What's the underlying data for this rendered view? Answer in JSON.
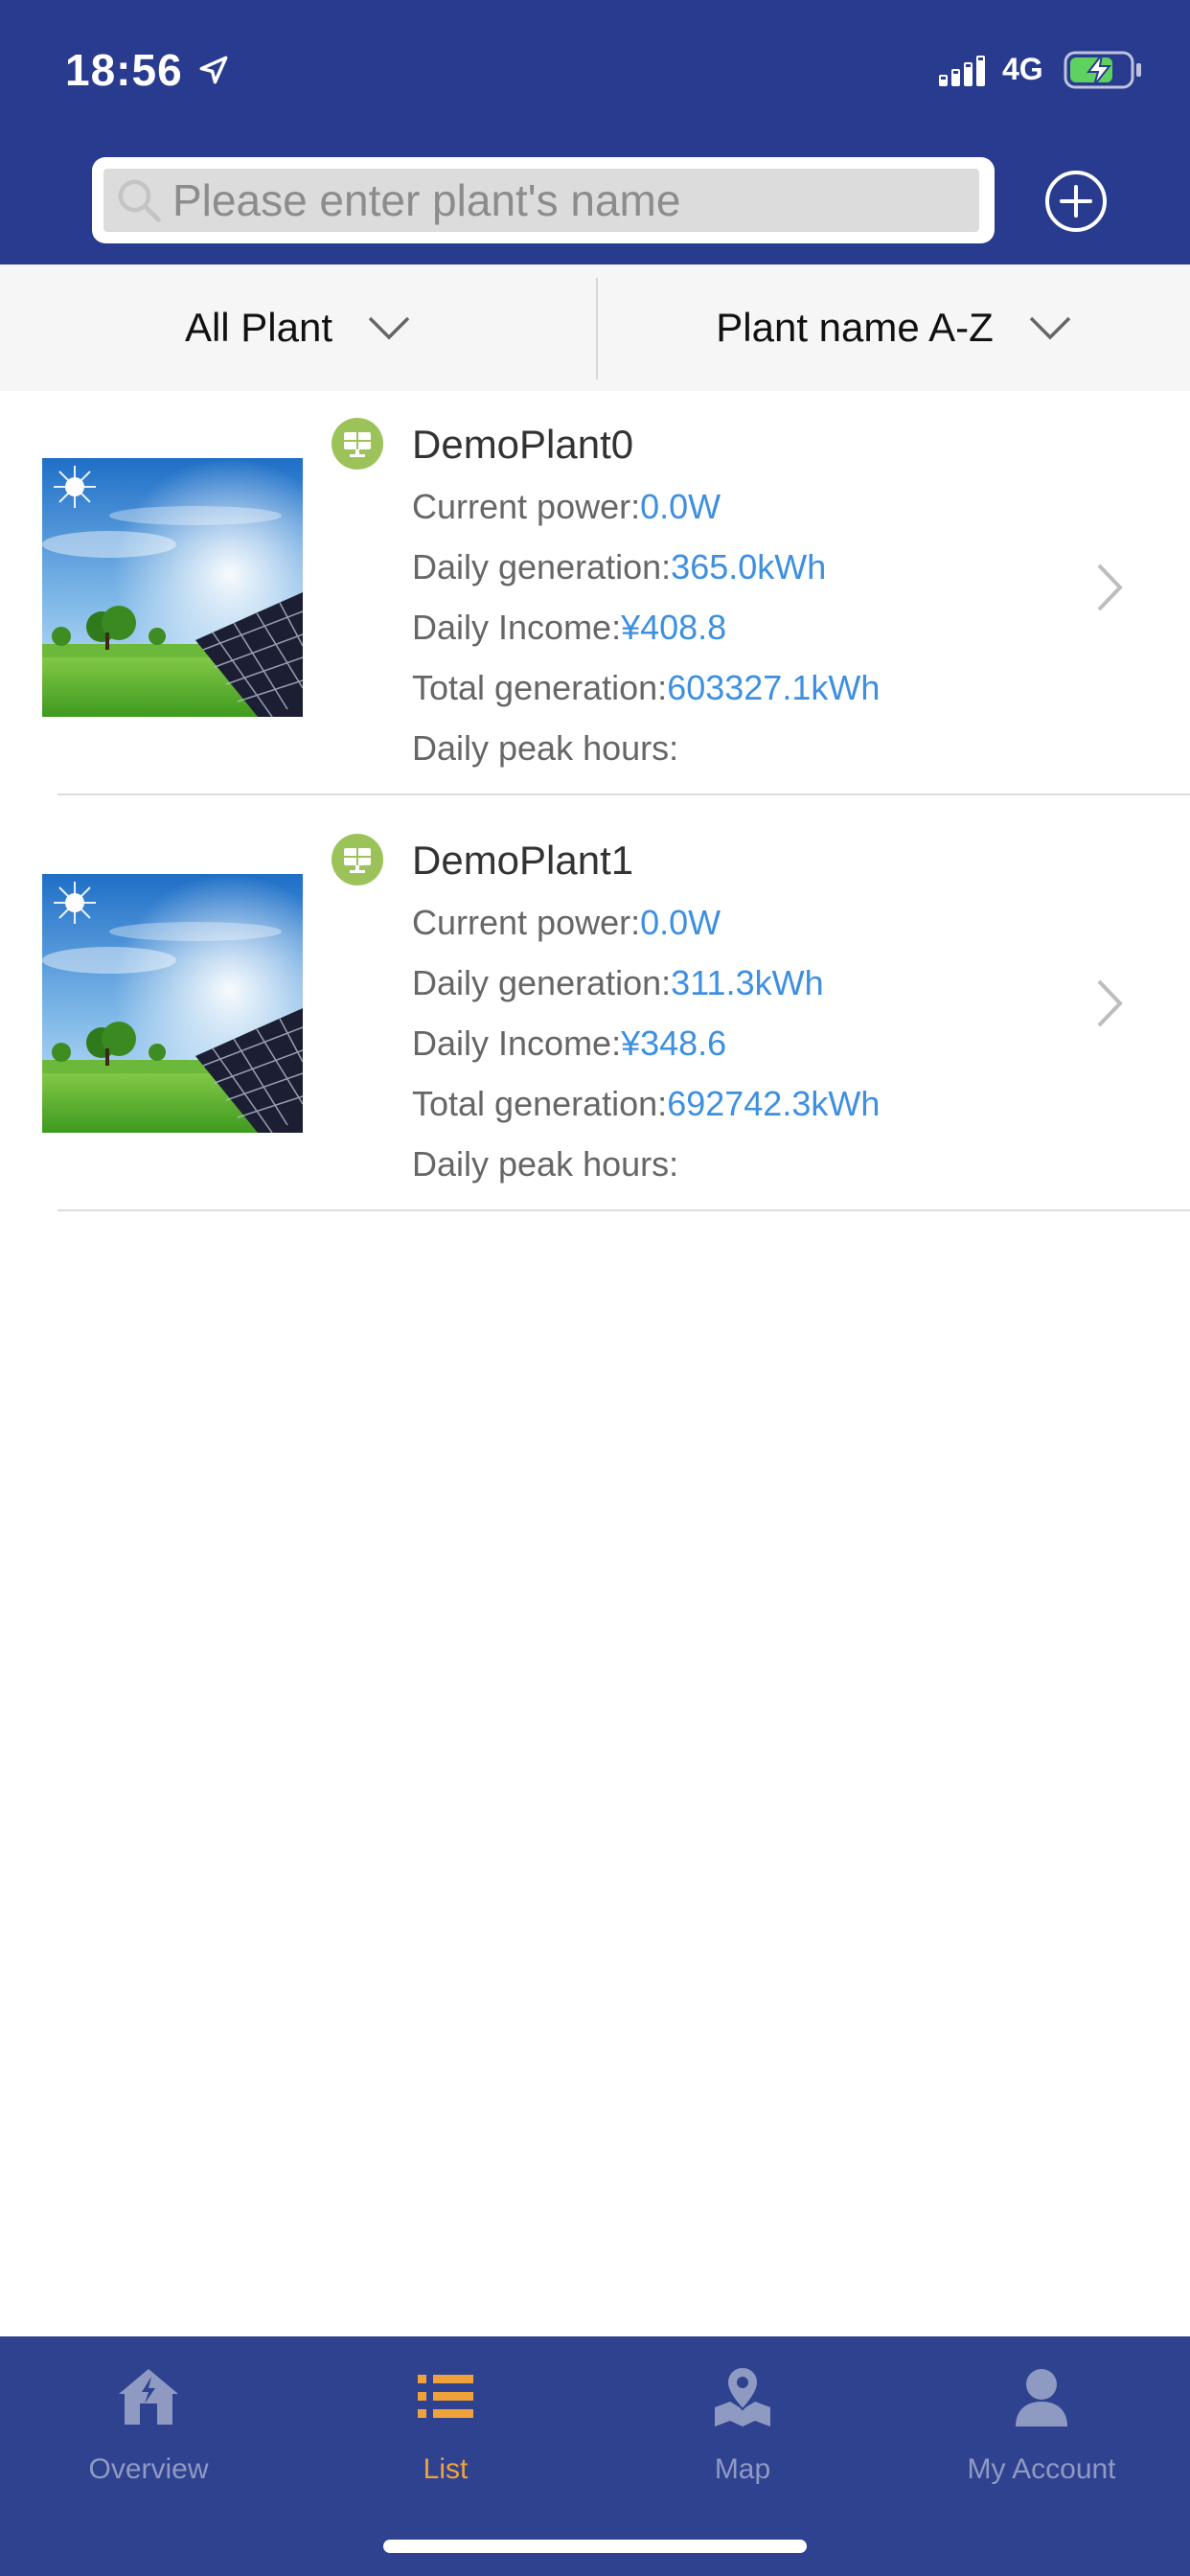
{
  "status_bar": {
    "time": "18:56",
    "network": "4G"
  },
  "search": {
    "placeholder": "Please enter plant's name"
  },
  "filters": {
    "left_label": "All Plant",
    "right_label": "Plant name A-Z"
  },
  "plants": [
    {
      "name": "DemoPlant0",
      "current_power_label": "Current power:",
      "current_power": "0.0W",
      "daily_generation_label": "Daily generation:",
      "daily_generation": "365.0kWh",
      "daily_income_label": "Daily Income:",
      "daily_income": "¥408.8",
      "total_generation_label": "Total generation:",
      "total_generation": "603327.1kWh",
      "daily_peak_hours_label": "Daily peak hours:",
      "daily_peak_hours": ""
    },
    {
      "name": "DemoPlant1",
      "current_power_label": "Current power:",
      "current_power": "0.0W",
      "daily_generation_label": "Daily generation:",
      "daily_generation": "311.3kWh",
      "daily_income_label": "Daily Income:",
      "daily_income": "¥348.6",
      "total_generation_label": "Total generation:",
      "total_generation": "692742.3kWh",
      "daily_peak_hours_label": "Daily peak hours:",
      "daily_peak_hours": ""
    }
  ],
  "tabs": [
    {
      "label": "Overview",
      "icon": "home-icon",
      "active": false
    },
    {
      "label": "List",
      "icon": "list-icon",
      "active": true
    },
    {
      "label": "Map",
      "icon": "map-pin-icon",
      "active": false
    },
    {
      "label": "My Account",
      "icon": "user-icon",
      "active": false
    }
  ],
  "colors": {
    "header_bg": "#293b8f",
    "tabbar_bg": "#2f4290",
    "value_blue": "#3d8fe0",
    "active_tab": "#f0a23a",
    "badge_green": "#9bc35a"
  }
}
